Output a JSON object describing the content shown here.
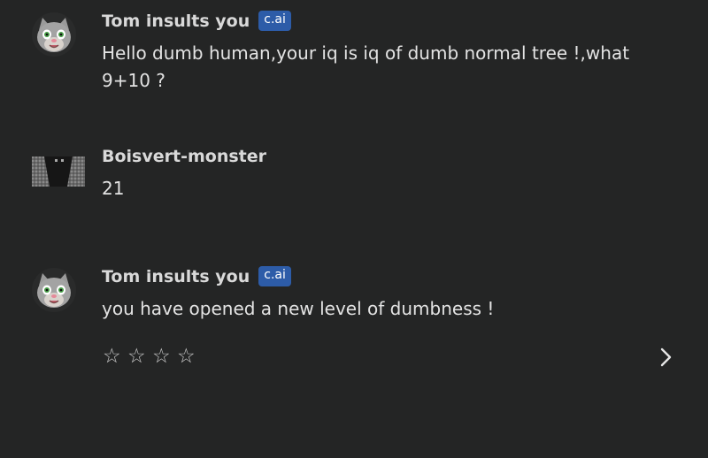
{
  "messages": [
    {
      "author": "Tom insults you",
      "badge": "c.ai",
      "avatar_icon": "talking-tom-cat-icon",
      "text": "Hello dumb human,your iq is iq of dumb normal tree !,what 9+10 ?"
    },
    {
      "author": "Boisvert-monster",
      "avatar_icon": "user-avatar-image",
      "text": "21"
    },
    {
      "author": "Tom insults you",
      "badge": "c.ai",
      "avatar_icon": "talking-tom-cat-icon",
      "text": "you have opened a new level of dumbness !"
    }
  ],
  "rating": {
    "stars": [
      "☆",
      "☆",
      "☆",
      "☆"
    ],
    "selected": 0
  },
  "next_icon": "chevron-right-icon",
  "colors": {
    "background": "#242525",
    "badge": "#2d5ca8",
    "text": "#e3e3e3"
  }
}
